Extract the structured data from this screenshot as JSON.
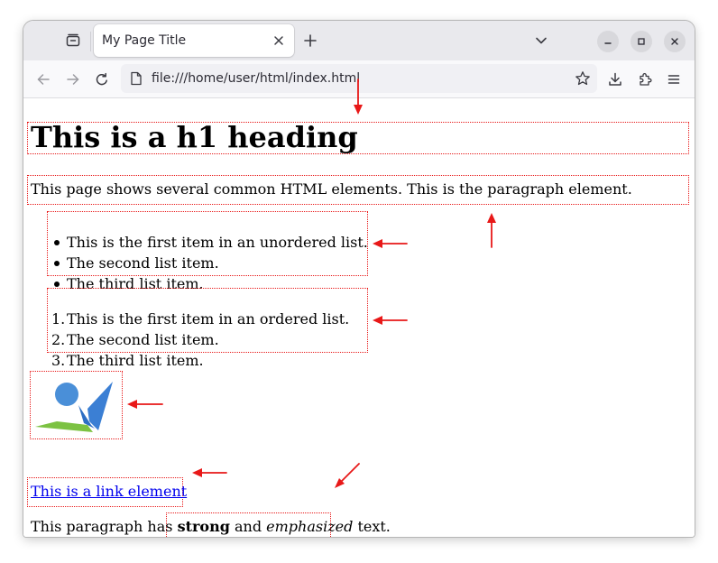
{
  "browser": {
    "tab_title": "My Page Title",
    "url": "file:///home/user/html/index.html"
  },
  "page": {
    "heading": "This is a h1 heading",
    "intro_paragraph": "This page shows several common HTML elements. This is the paragraph element.",
    "unordered_list": [
      "This is the first item in an unordered list.",
      "The second list item.",
      "The third list item."
    ],
    "ordered_list": {
      "numbers": [
        "1.",
        "2.",
        "3."
      ],
      "items": [
        "This is the first item in an ordered list.",
        "The second list item.",
        "The third list item."
      ]
    },
    "image_icon": "blue-green-logo-icon",
    "link_text": "This is a link element",
    "last_paragraph": {
      "before": "This paragraph has ",
      "strong": "strong",
      "middle": " and ",
      "em": "emphasized",
      "after": " text."
    }
  },
  "annotation_color": "#e81818",
  "link_color": "#0000ee"
}
